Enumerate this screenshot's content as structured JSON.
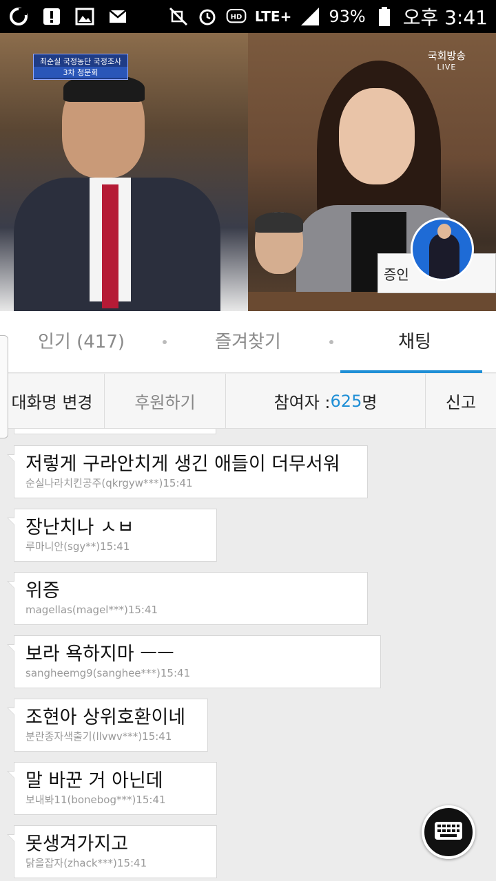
{
  "status_bar": {
    "battery": "93%",
    "network": "LTE+",
    "time": "오후 3:41"
  },
  "video": {
    "caption_top": "최순실 국정농단 국정조사",
    "caption_bottom": "3차 청문회",
    "broadcaster": "국회방송",
    "live": "LIVE",
    "nameplate": "증인"
  },
  "tabs": [
    {
      "label": "인기 (417)",
      "active": false
    },
    {
      "label": "즐겨찾기",
      "active": false
    },
    {
      "label": "채팅",
      "active": true
    }
  ],
  "toolbar": {
    "rename": "대화명 변경",
    "donate": "후원하기",
    "participants_label": "참여자 : ",
    "participants_count": "625",
    "participants_unit": "명",
    "report": "신고"
  },
  "messages": [
    {
      "text": "저렇게 구라안치게 생긴 애들이 더무서워",
      "meta": "순실나라치킨공주(qkrgyw***)15:41"
    },
    {
      "text": "장난치나 ㅅㅂ",
      "meta": "루마니안(sgy**)15:41"
    },
    {
      "text": "위증",
      "meta": "magellas(magel***)15:41"
    },
    {
      "text": "보라 욕하지마 ㅡㅡ",
      "meta": "sangheemg9(sanghee***)15:41"
    },
    {
      "text": "조현아 상위호환이네",
      "meta": "분란종자색출기(llvwv***)15:41"
    },
    {
      "text": "말 바꾼 거 아닌데",
      "meta": "보내봐11(bonebog***)15:41"
    },
    {
      "text": "못생겨가지고",
      "meta": "닭을잡자(zhack***)15:41"
    }
  ],
  "colors": {
    "accent": "#1f8fd6",
    "status_bar": "#000000",
    "chat_bg": "#ececec"
  }
}
